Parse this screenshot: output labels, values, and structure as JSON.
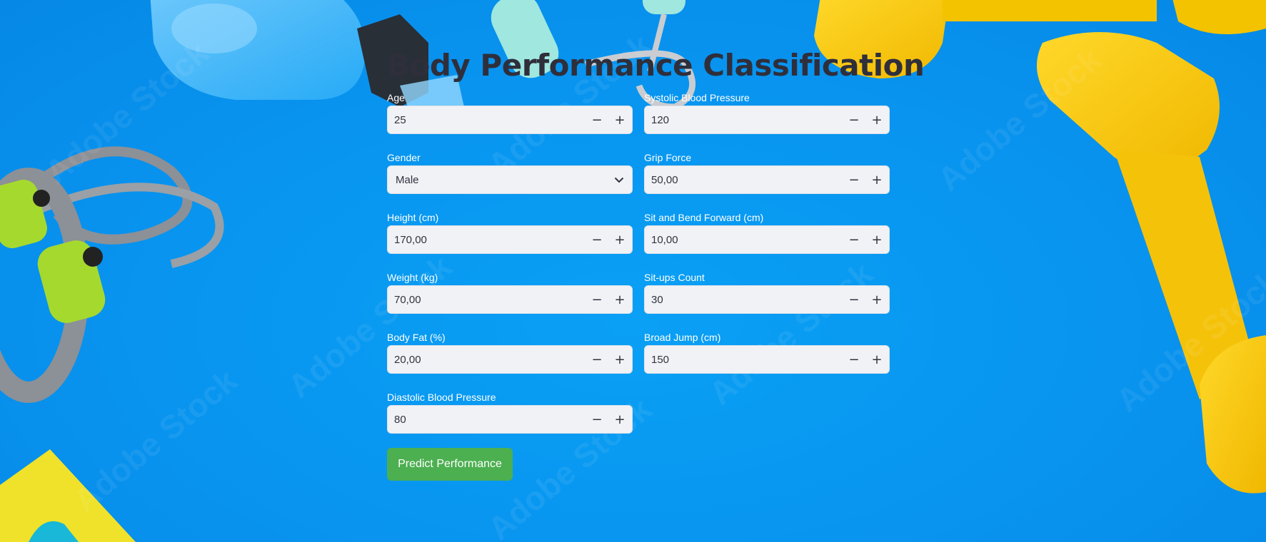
{
  "page": {
    "title": "Body Performance Classification"
  },
  "form": {
    "left": [
      {
        "label": "Age",
        "value": "25",
        "type": "number"
      },
      {
        "label": "Gender",
        "value": "Male",
        "type": "select"
      },
      {
        "label": "Height (cm)",
        "value": "170,00",
        "type": "number"
      },
      {
        "label": "Weight (kg)",
        "value": "70,00",
        "type": "number"
      },
      {
        "label": "Body Fat (%)",
        "value": "20,00",
        "type": "number"
      },
      {
        "label": "Diastolic Blood Pressure",
        "value": "80",
        "type": "number"
      }
    ],
    "right": [
      {
        "label": "Systolic Blood Pressure",
        "value": "120",
        "type": "number"
      },
      {
        "label": "Grip Force",
        "value": "50,00",
        "type": "number"
      },
      {
        "label": "Sit and Bend Forward (cm)",
        "value": "10,00",
        "type": "number"
      },
      {
        "label": "Sit-ups Count",
        "value": "30",
        "type": "number"
      },
      {
        "label": "Broad Jump (cm)",
        "value": "150",
        "type": "number"
      }
    ],
    "stepper_minus": "−",
    "stepper_plus": "+",
    "submit_label": "Predict Performance"
  },
  "background": {
    "watermark": "Adobe Stock",
    "colors": {
      "base": "#0894ef",
      "dumbbell": "#f5c20a",
      "rope_handle": "#a6d92e",
      "towel": "#f0e22a"
    }
  }
}
